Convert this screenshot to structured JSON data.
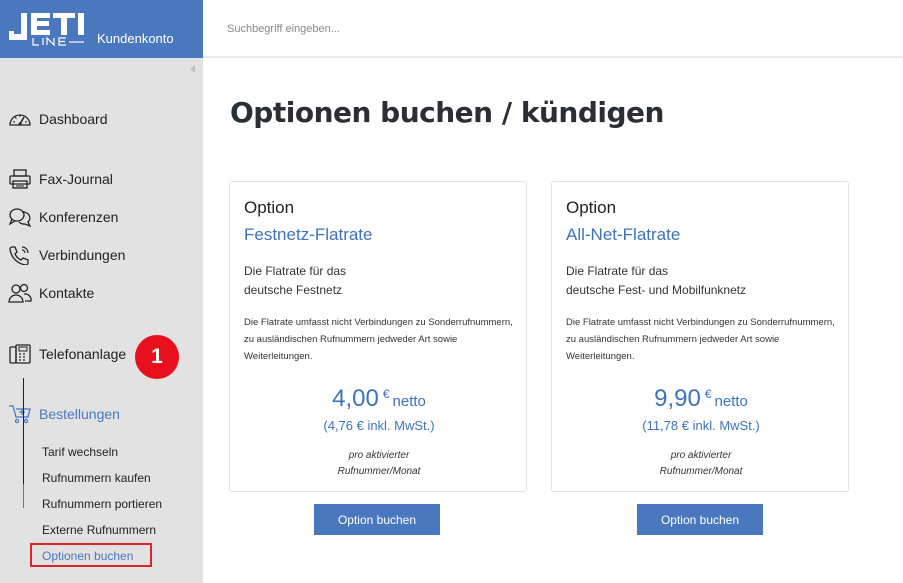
{
  "header": {
    "logo_text": "JETI LINE",
    "brand_sub": "Kundenkonto",
    "search_placeholder": "Suchbegriff eingeben..."
  },
  "sidebar": {
    "items": [
      {
        "label": "Dashboard",
        "icon": "dashboard-gauge-icon"
      },
      {
        "label": "Fax-Journal",
        "icon": "fax-icon"
      },
      {
        "label": "Konferenzen",
        "icon": "conference-icon"
      },
      {
        "label": "Verbindungen",
        "icon": "phone-connections-icon"
      },
      {
        "label": "Kontakte",
        "icon": "contacts-icon"
      },
      {
        "label": "Telefonanlage",
        "icon": "phone-system-icon"
      },
      {
        "label": "Bestellungen",
        "icon": "cart-icon",
        "active": true
      }
    ],
    "badge": "1",
    "subitems": [
      {
        "label": "Tarif wechseln"
      },
      {
        "label": "Rufnummern kaufen"
      },
      {
        "label": "Rufnummern portieren"
      },
      {
        "label": "Externe Rufnummern"
      },
      {
        "label": "Optionen buchen",
        "active": true
      }
    ]
  },
  "main": {
    "title": "Optionen buchen / kündigen",
    "cards": [
      {
        "kicker": "Option",
        "name": "Festnetz-Flatrate",
        "desc_line1": "Die Flatrate für das",
        "desc_line2": "deutsche Festnetz",
        "note": "Die Flatrate umfasst nicht Verbindungen zu Sonderrufnummern, zu ausländischen Rufnummern jedweder Art sowie Weiterleitungen.",
        "price": "4,00",
        "currency": "€",
        "netto": "netto",
        "gross": "(4,76 € inkl. MwSt.)",
        "per_line1": "pro aktivierter",
        "per_line2": "Rufnummer/Monat",
        "button": "Option buchen"
      },
      {
        "kicker": "Option",
        "name": "All-Net-Flatrate",
        "desc_line1": "Die Flatrate für das",
        "desc_line2": "deutsche Fest- und Mobilfunknetz",
        "note": "Die Flatrate umfasst nicht Verbindungen zu Sonderrufnummern, zu ausländischen Rufnummern jedweder Art sowie Weiterleitungen.",
        "price": "9,90",
        "currency": "€",
        "netto": "netto",
        "gross": "(11,78 € inkl. MwSt.)",
        "per_line1": "pro aktivierter",
        "per_line2": "Rufnummer/Monat",
        "button": "Option buchen"
      }
    ]
  },
  "colors": {
    "brand": "#4a78be",
    "link": "#3f73b8",
    "badge": "#e8101c",
    "highlight": "#d9262c",
    "sidebar_bg": "#e2e2e2"
  }
}
